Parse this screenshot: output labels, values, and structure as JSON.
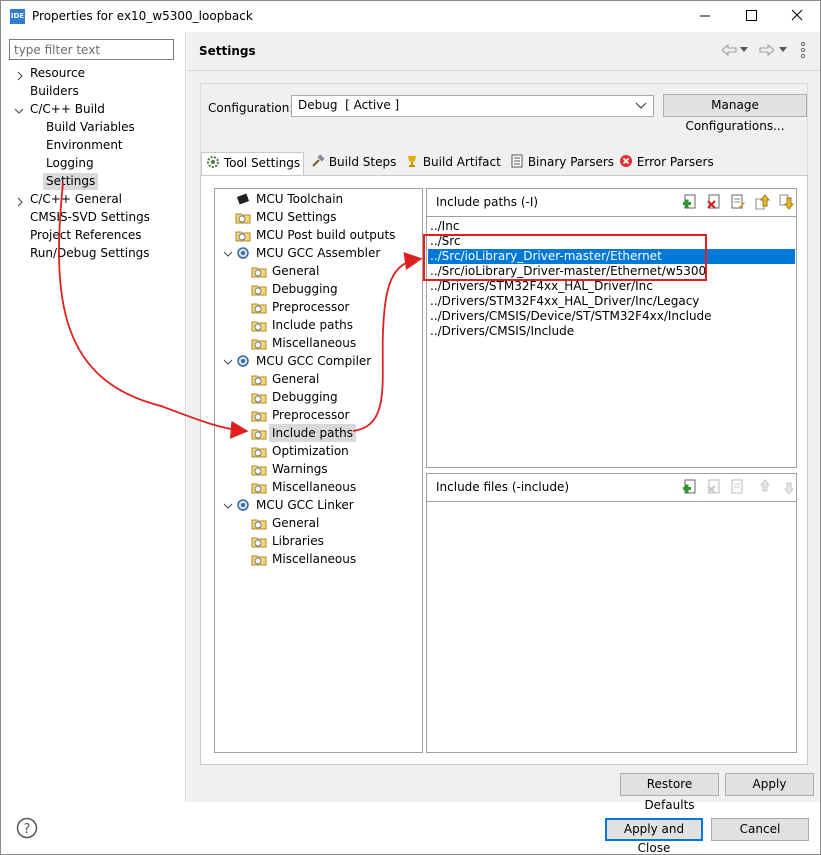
{
  "window": {
    "title": "Properties for ex10_w5300_loopback",
    "icon_text": "IDE"
  },
  "filter": {
    "placeholder": "type filter text"
  },
  "left_tree": [
    {
      "label": "Resource"
    },
    {
      "label": "Builders"
    },
    {
      "label": "C/C++ Build"
    },
    {
      "label": "Build Variables"
    },
    {
      "label": "Environment"
    },
    {
      "label": "Logging"
    },
    {
      "label": "Settings"
    },
    {
      "label": "C/C++ General"
    },
    {
      "label": "CMSIS-SVD Settings"
    },
    {
      "label": "Project References"
    },
    {
      "label": "Run/Debug Settings"
    }
  ],
  "header": {
    "title": "Settings"
  },
  "config": {
    "label": "Configuration:",
    "value": "Debug  [ Active ]",
    "manage_button": "Manage Configurations..."
  },
  "tabs": [
    {
      "label": "Tool Settings"
    },
    {
      "label": "Build Steps"
    },
    {
      "label": "Build Artifact"
    },
    {
      "label": "Binary Parsers"
    },
    {
      "label": "Error Parsers"
    }
  ],
  "tool_tree": [
    {
      "label": "MCU Toolchain"
    },
    {
      "label": "MCU Settings"
    },
    {
      "label": "MCU Post build outputs"
    },
    {
      "label": "MCU GCC Assembler"
    },
    {
      "label": "General"
    },
    {
      "label": "Debugging"
    },
    {
      "label": "Preprocessor"
    },
    {
      "label": "Include paths"
    },
    {
      "label": "Miscellaneous"
    },
    {
      "label": "MCU GCC Compiler"
    },
    {
      "label": "General"
    },
    {
      "label": "Debugging"
    },
    {
      "label": "Preprocessor"
    },
    {
      "label": "Include paths"
    },
    {
      "label": "Optimization"
    },
    {
      "label": "Warnings"
    },
    {
      "label": "Miscellaneous"
    },
    {
      "label": "MCU GCC Linker"
    },
    {
      "label": "General"
    },
    {
      "label": "Libraries"
    },
    {
      "label": "Miscellaneous"
    }
  ],
  "include_paths": {
    "title": "Include paths (-I)",
    "items": [
      "../Inc",
      "../Src",
      "../Src/ioLibrary_Driver-master/Ethernet",
      "../Src/ioLibrary_Driver-master/Ethernet/w5300",
      "../Drivers/STM32F4xx_HAL_Driver/Inc",
      "../Drivers/STM32F4xx_HAL_Driver/Inc/Legacy",
      "../Drivers/CMSIS/Device/ST/STM32F4xx/Include",
      "../Drivers/CMSIS/Include"
    ],
    "selected_index": 2
  },
  "include_files": {
    "title": "Include files (-include)"
  },
  "buttons": {
    "restore_defaults": "Restore Defaults",
    "apply": "Apply",
    "apply_close": "Apply and Close",
    "cancel": "Cancel"
  },
  "colors": {
    "selection": "#0078d7",
    "annotation": "#e02020"
  }
}
